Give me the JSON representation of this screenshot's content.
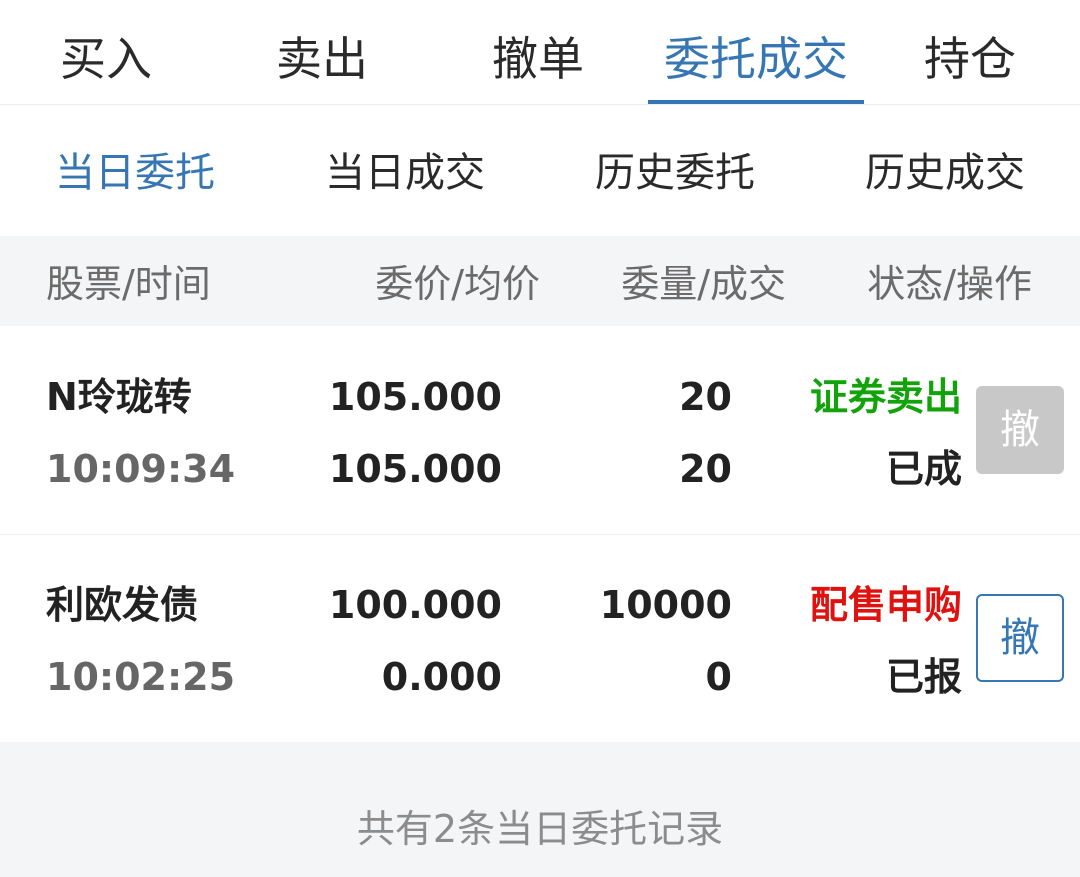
{
  "top_tabs": [
    {
      "label": "买入"
    },
    {
      "label": "卖出"
    },
    {
      "label": "撤单"
    },
    {
      "label": "委托成交"
    },
    {
      "label": "持仓"
    }
  ],
  "sub_tabs": [
    {
      "label": "当日委托"
    },
    {
      "label": "当日成交"
    },
    {
      "label": "历史委托"
    },
    {
      "label": "历史成交"
    }
  ],
  "table": {
    "headers": [
      "股票/时间",
      "委价/均价",
      "委量/成交",
      "状态/操作"
    ],
    "rows": [
      {
        "name": "N玲珑转",
        "time": "10:09:34",
        "order_price": "105.000",
        "avg_price": "105.000",
        "order_qty": "20",
        "filled_qty": "20",
        "direction": "证券卖出",
        "status": "已成",
        "cancel_label": "撤"
      },
      {
        "name": "利欧发债",
        "time": "10:02:25",
        "order_price": "100.000",
        "avg_price": "0.000",
        "order_qty": "10000",
        "filled_qty": "0",
        "direction": "配售申购",
        "status": "已报",
        "cancel_label": "撤"
      }
    ]
  },
  "footer": {
    "summary": "共有2条当日委托记录"
  },
  "colors": {
    "accent": "#3677b3",
    "sell": "#12a20a",
    "subscribe": "#e0120f",
    "disabled_button": "#c8c8c8"
  }
}
